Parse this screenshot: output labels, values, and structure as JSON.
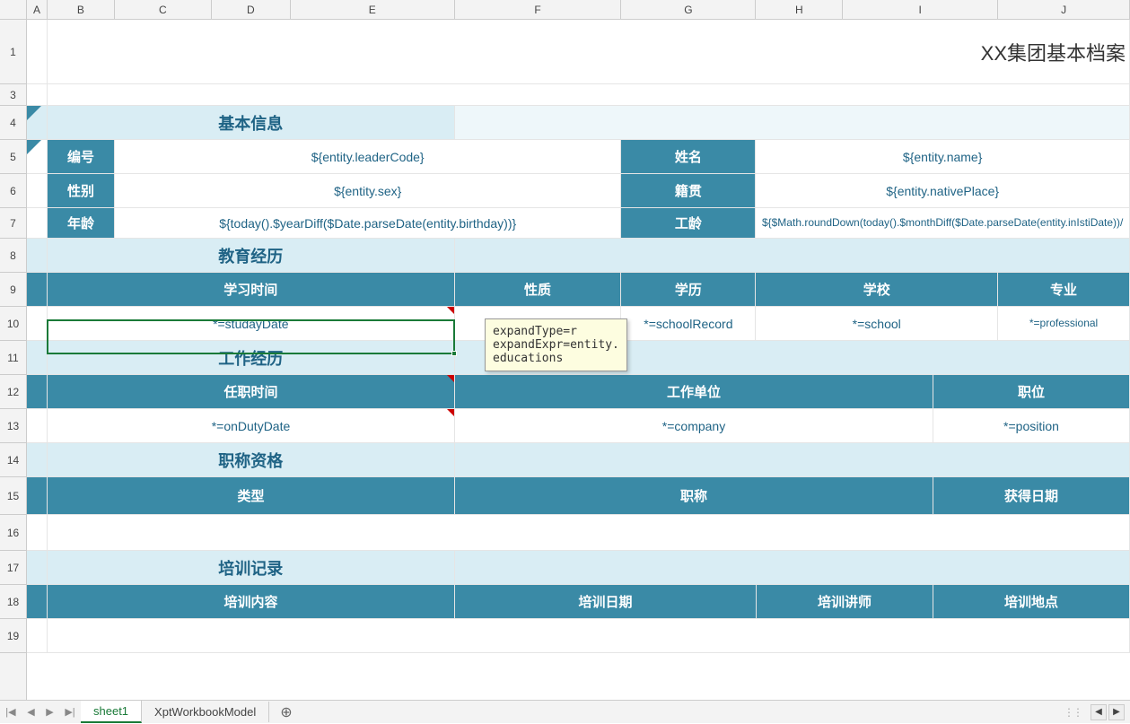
{
  "columns": [
    "A",
    "B",
    "C",
    "D",
    "E",
    "F",
    "G",
    "H",
    "I",
    "J"
  ],
  "rows": [
    "1",
    "3",
    "4",
    "5",
    "6",
    "7",
    "8",
    "9",
    "10",
    "11",
    "12",
    "13",
    "14",
    "15",
    "16",
    "17",
    "18",
    "19"
  ],
  "title": "XX集团基本档案",
  "sections": {
    "basic": "基本信息",
    "edu": "教育经历",
    "work": "工作经历",
    "title_qual": "职称资格",
    "training": "培训记录"
  },
  "basic_fields": {
    "code_label": "编号",
    "code_val": "${entity.leaderCode}",
    "name_label": "姓名",
    "name_val": "${entity.name}",
    "sex_label": "性别",
    "sex_val": "${entity.sex}",
    "native_label": "籍贯",
    "native_val": "${entity.nativePlace}",
    "age_label": "年龄",
    "age_val": "${today().$yearDiff($Date.parseDate(entity.birthday))}",
    "seniority_label": "工龄",
    "seniority_val": "${$Math.roundDown(today().$monthDiff($Date.parseDate(entity.inIstiDate))/"
  },
  "edu_headers": {
    "study_time": "学习时间",
    "nature": "性质",
    "degree": "学历",
    "school": "学校",
    "major": "专业"
  },
  "edu_values": {
    "study_time": "*=studayDate",
    "school_record": "*=schoolRecord",
    "school": "*=school",
    "professional": "*=professional"
  },
  "work_headers": {
    "duty_time": "任职时间",
    "company": "工作单位",
    "position": "职位"
  },
  "work_values": {
    "duty_time": "*=onDutyDate",
    "company": "*=company",
    "position": "*=position"
  },
  "title_headers": {
    "type": "类型",
    "title_name": "职称",
    "obtain_date": "获得日期"
  },
  "training_headers": {
    "content": "培训内容",
    "date": "培训日期",
    "teacher": "培训讲师",
    "place": "培训地点"
  },
  "comment": "expandType=r\nexpandExpr=entity.\neducations",
  "tabs": {
    "sheet1": "sheet1",
    "model": "XptWorkbookModel"
  },
  "icons": {
    "add": "⊕",
    "first": "|◀",
    "prev": "◀",
    "next": "▶",
    "last": "▶|",
    "left_arrow": "◀",
    "right_arrow": "▶"
  }
}
